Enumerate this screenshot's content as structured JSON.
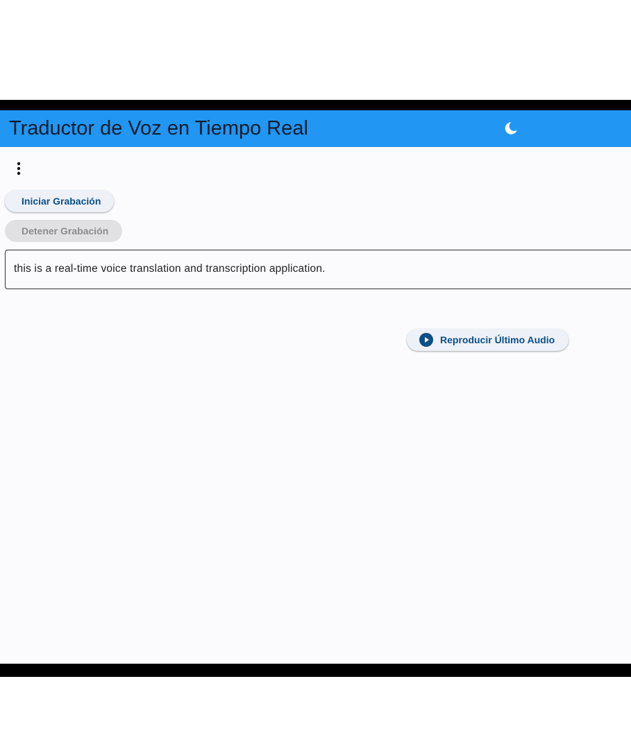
{
  "appbar": {
    "title": "Traductor de Voz en Tiempo Real",
    "theme_toggle_icon": "moon-icon",
    "background_color": "#2196f3"
  },
  "menu": {
    "icon": "more-vert-icon"
  },
  "controls": {
    "start_label": "Iniciar Grabación",
    "stop_label": "Detener Grabación",
    "stop_enabled": false
  },
  "transcript": {
    "text": "this is a real-time voice translation and transcription application."
  },
  "playback": {
    "label": "Reproducir Último Audio",
    "icon": "play-circle-icon",
    "accent_color": "#0b4f86"
  }
}
